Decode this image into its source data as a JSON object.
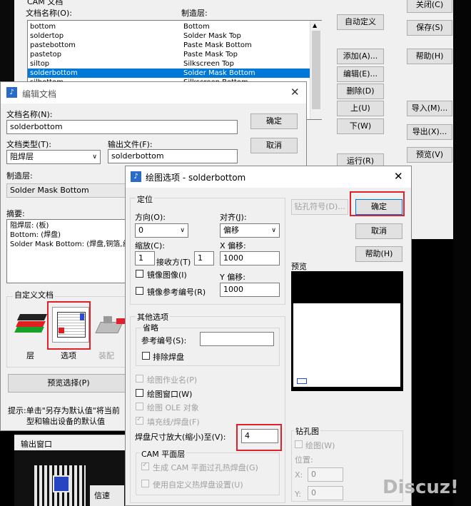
{
  "cam_window": {
    "group_title": "CAM 文档",
    "col_name": "文档名称(O):",
    "col_layer": "制造层:",
    "rows": [
      {
        "name": "bottom",
        "layer": "Bottom",
        "selected": false
      },
      {
        "name": "soldertop",
        "layer": "Solder Mask Top",
        "selected": false
      },
      {
        "name": "pastebottom",
        "layer": "Paste Mask Bottom",
        "selected": false
      },
      {
        "name": "pastetop",
        "layer": "Paste Mask Top",
        "selected": false
      },
      {
        "name": "siltop",
        "layer": "Silkscreen Top",
        "selected": false
      },
      {
        "name": "solderbottom",
        "layer": "Solder Mask Bottom",
        "selected": true
      },
      {
        "name": "silbottom",
        "layer": "Silkscreen Bottom",
        "selected": false
      }
    ],
    "btn_custom": "自动定义",
    "btn_add": "添加(A)...",
    "btn_edit": "编辑(E)...",
    "btn_delete": "删除(D)",
    "btn_up": "上(U)",
    "btn_down": "下(W)",
    "btn_run": "运行(R)",
    "btn_close": "关闭(C)",
    "btn_save": "保存(S)",
    "btn_help": "帮助(H)",
    "btn_import": "导入(M)...",
    "btn_export": "导出(X)...",
    "btn_preview": "预览(V)"
  },
  "edit_doc": {
    "title": "编辑文档",
    "name_label": "文档名称(N):",
    "name_value": "solderbottom",
    "ok": "确定",
    "cancel": "取消",
    "type_label": "文档类型(T):",
    "type_value": "阻焊层",
    "output_label": "输出文件(F):",
    "output_value": "solderbottom",
    "layer_label": "制造层:",
    "layer_value": "Solder Mask Bottom",
    "summary_label": "摘要:",
    "summary_lines": [
      "阻焊层: (板)",
      "Bottom: (焊盘)",
      "Solder Mask Bottom: (焊盘,铜箔,丝"
    ],
    "custom_label": "自定义文档",
    "icon_layers": "层",
    "icon_options": "选项",
    "icon_assembly": "装配",
    "preview_select": "预览选择(P)",
    "tip_line1": "提示:单击\"另存为默认值\"将当前",
    "tip_line2": "型和输出设备的默认值"
  },
  "output_window": {
    "label": "输出窗口"
  },
  "plot_options": {
    "title": "绘图选项 - solderbottom",
    "position_group": "定位",
    "direction_label": "方向(O):",
    "direction_value": "0",
    "align_label": "对齐(J):",
    "align_value": "偏移",
    "scale_label": "缩放(C):",
    "scale_value": "1",
    "shrink_label": "接收方(T)",
    "shrink_value": "1",
    "x_offset_label": "X 偏移:",
    "x_offset_value": "1000",
    "y_offset_label": "Y 偏移:",
    "y_offset_value": "1000",
    "mirror_image": "镜像图像(I)",
    "mirror_ref": "镜像参考编号(R)",
    "drill_symbol_btn": "钻孔符号(D)...",
    "ok": "确定",
    "cancel": "取消",
    "help": "帮助(H)",
    "preview_label": "预览",
    "other_group": "其他选项",
    "omit_group": "省略",
    "ref_label": "参考编号(S):",
    "ref_value": "",
    "exclude_pads": "排除焊盘",
    "plot_job_name": "绘图作业名(P)",
    "plot_window": "绘图窗口(W)",
    "plot_ole": "绘图 OLE 对象",
    "fill_lines": "填充线/焊盘(F)",
    "pad_size_label": "焊盘尺寸放大(缩小)至(V):",
    "pad_size_value": "4",
    "drill_group": "钻孔图",
    "drill_plot": "绘图(W)",
    "position_label": "位置:",
    "drill_x_label": "X:",
    "drill_x_value": "0",
    "drill_y_label": "Y:",
    "drill_y_value": "0",
    "cam_group": "CAM 平面层",
    "gen_thermal": "生成 CAM 平面过孔热焊盘(G)",
    "custom_thermal": "使用自定义热焊盘设置(U)"
  },
  "taskbar": {
    "text": "信速"
  },
  "watermark": "Discuz!"
}
